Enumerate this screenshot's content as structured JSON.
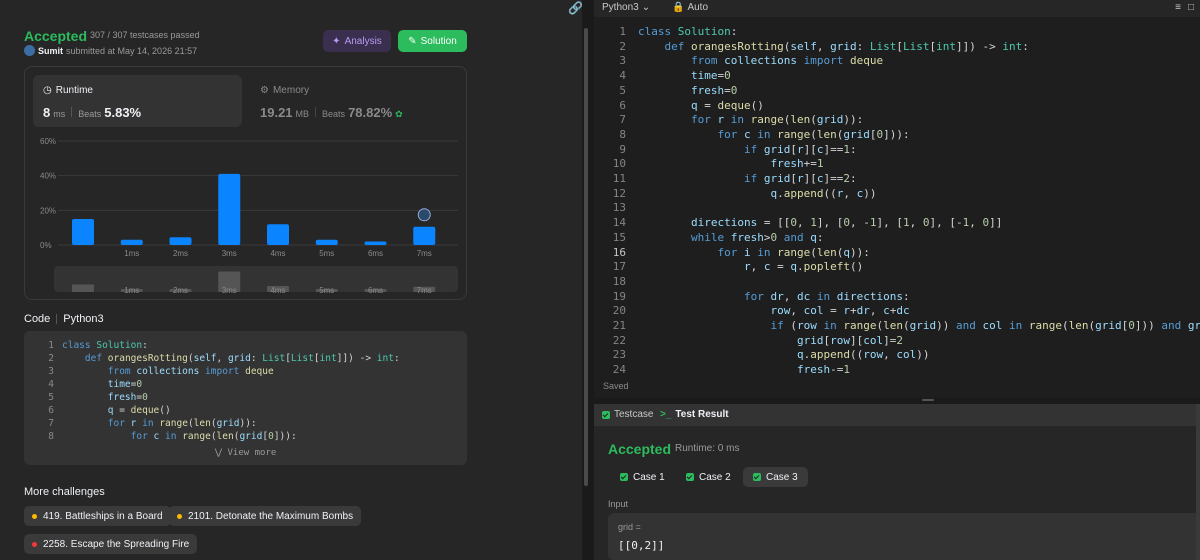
{
  "submission": {
    "status": "Accepted",
    "testcases": "307 / 307 testcases passed",
    "user": "Sumit",
    "submitted_text": "submitted at May 14, 2026 21:57",
    "analysis_label": "Analysis",
    "solution_label": "Solution"
  },
  "runtime": {
    "label": "Runtime",
    "value": "8",
    "unit": "ms",
    "beats_label": "Beats",
    "beats_pct": "5.83%"
  },
  "memory": {
    "label": "Memory",
    "value": "19.21",
    "unit": "MB",
    "beats_label": "Beats",
    "beats_pct": "78.82%"
  },
  "chart_data": {
    "type": "bar",
    "y_tick_labels": [
      "60%",
      "40%",
      "20%",
      "0%"
    ],
    "ylim": [
      0,
      60
    ],
    "categories": [
      "",
      "1ms",
      "2ms",
      "3ms",
      "4ms",
      "5ms",
      "6ms",
      "7ms"
    ],
    "values": [
      15,
      3,
      4.5,
      41,
      12,
      3,
      2,
      10.5
    ],
    "color": "#0a84ff",
    "user_bar_index": 7,
    "overview_labels": [
      "1ms",
      "2ms",
      "3ms",
      "4ms",
      "5ms",
      "6ms",
      "7ms"
    ]
  },
  "code_section": {
    "label": "Code",
    "language": "Python3",
    "view_more": "View more",
    "lines": [
      "class Solution:",
      "    def orangesRotting(self, grid: List[List[int]]) -> int:",
      "        from collections import deque",
      "        time=0",
      "        fresh=0",
      "        q = deque()",
      "        for r in range(len(grid)):",
      "            for c in range(len(grid[0])):"
    ]
  },
  "more_challenges": {
    "title": "More challenges",
    "items": [
      {
        "label": "419. Battleships in a Board",
        "color": "#ffb800"
      },
      {
        "label": "2101. Detonate the Maximum Bombs",
        "color": "#ffb800"
      },
      {
        "label": "2258. Escape the Spreading Fire",
        "color": "#f63737"
      }
    ]
  },
  "editor": {
    "language": "Python3",
    "mode": "Auto",
    "saved": "Saved",
    "current_line": 16,
    "lines": [
      "class Solution:",
      "    def orangesRotting(self, grid: List[List[int]]) -> int:",
      "        from collections import deque",
      "        time=0",
      "        fresh=0",
      "        q = deque()",
      "        for r in range(len(grid)):",
      "            for c in range(len(grid[0])):",
      "                if grid[r][c]==1:",
      "                    fresh+=1",
      "                if grid[r][c]==2:",
      "                    q.append((r, c))",
      "",
      "        directions = [[0, 1], [0, -1], [1, 0], [-1, 0]]",
      "        while fresh>0 and q:",
      "            for i in range(len(q)):",
      "                r, c = q.popleft()",
      "",
      "                for dr, dc in directions:",
      "                    row, col = r+dr, c+dc",
      "                    if (row in range(len(grid)) and col in range(len(grid[0])) and grid[row][col",
      "                        grid[row][col]=2",
      "                        q.append((row, col))",
      "                        fresh-=1"
    ]
  },
  "test_panel": {
    "testcase_tab": "Testcase",
    "result_tab": "Test Result",
    "status": "Accepted",
    "runtime": "Runtime: 0 ms",
    "cases": [
      "Case 1",
      "Case 2",
      "Case 3"
    ],
    "active_case": 2,
    "input_label": "Input",
    "input_key": "grid =",
    "input_value": "[[0,2]]"
  }
}
